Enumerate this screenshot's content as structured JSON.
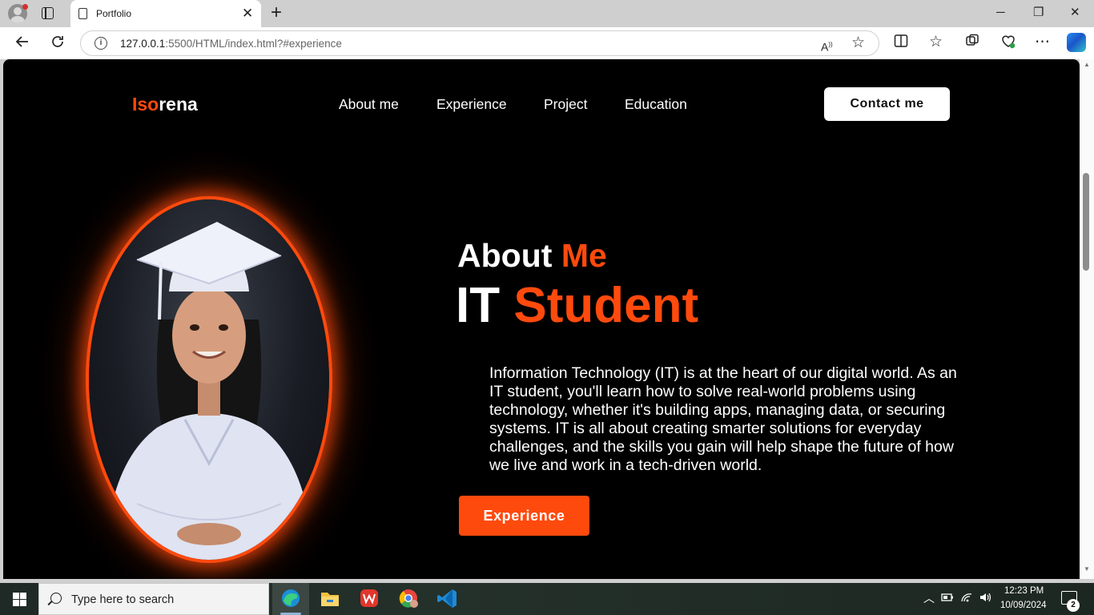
{
  "browser": {
    "tab_title": "Portfolio",
    "url_host": "127.0.0.1",
    "url_path": ":5500/HTML/index.html?#experience",
    "tab_close": "✕",
    "new_tab": "+",
    "window_controls": {
      "minimize": "─",
      "restore": "❐",
      "close": "✕"
    }
  },
  "site": {
    "logo_accent": "Iso",
    "logo_rest": "rena",
    "nav": [
      "About me",
      "Experience",
      "Project",
      "Education"
    ],
    "contact_button": "Contact me",
    "about_prefix": "About",
    "about_accent": "Me",
    "role_prefix": "IT",
    "role_accent": "Student",
    "description": "Information Technology (IT) is at the heart of our digital world. As an IT student, you'll learn how to solve real-world problems using technology, whether it's building apps, managing data, or securing systems. IT is all about creating smarter solutions for everyday challenges, and the skills you gain will help shape the future of how we live and work in a tech-driven world.",
    "experience_button": "Experience",
    "accent_color": "#ff4a0d"
  },
  "taskbar": {
    "search_placeholder": "Type here to search",
    "time": "12:23 PM",
    "date": "10/09/2024",
    "notification_count": "2",
    "apps": [
      "edge-icon",
      "file-explorer-icon",
      "wps-office-icon",
      "chrome-icon",
      "vscode-icon"
    ]
  }
}
